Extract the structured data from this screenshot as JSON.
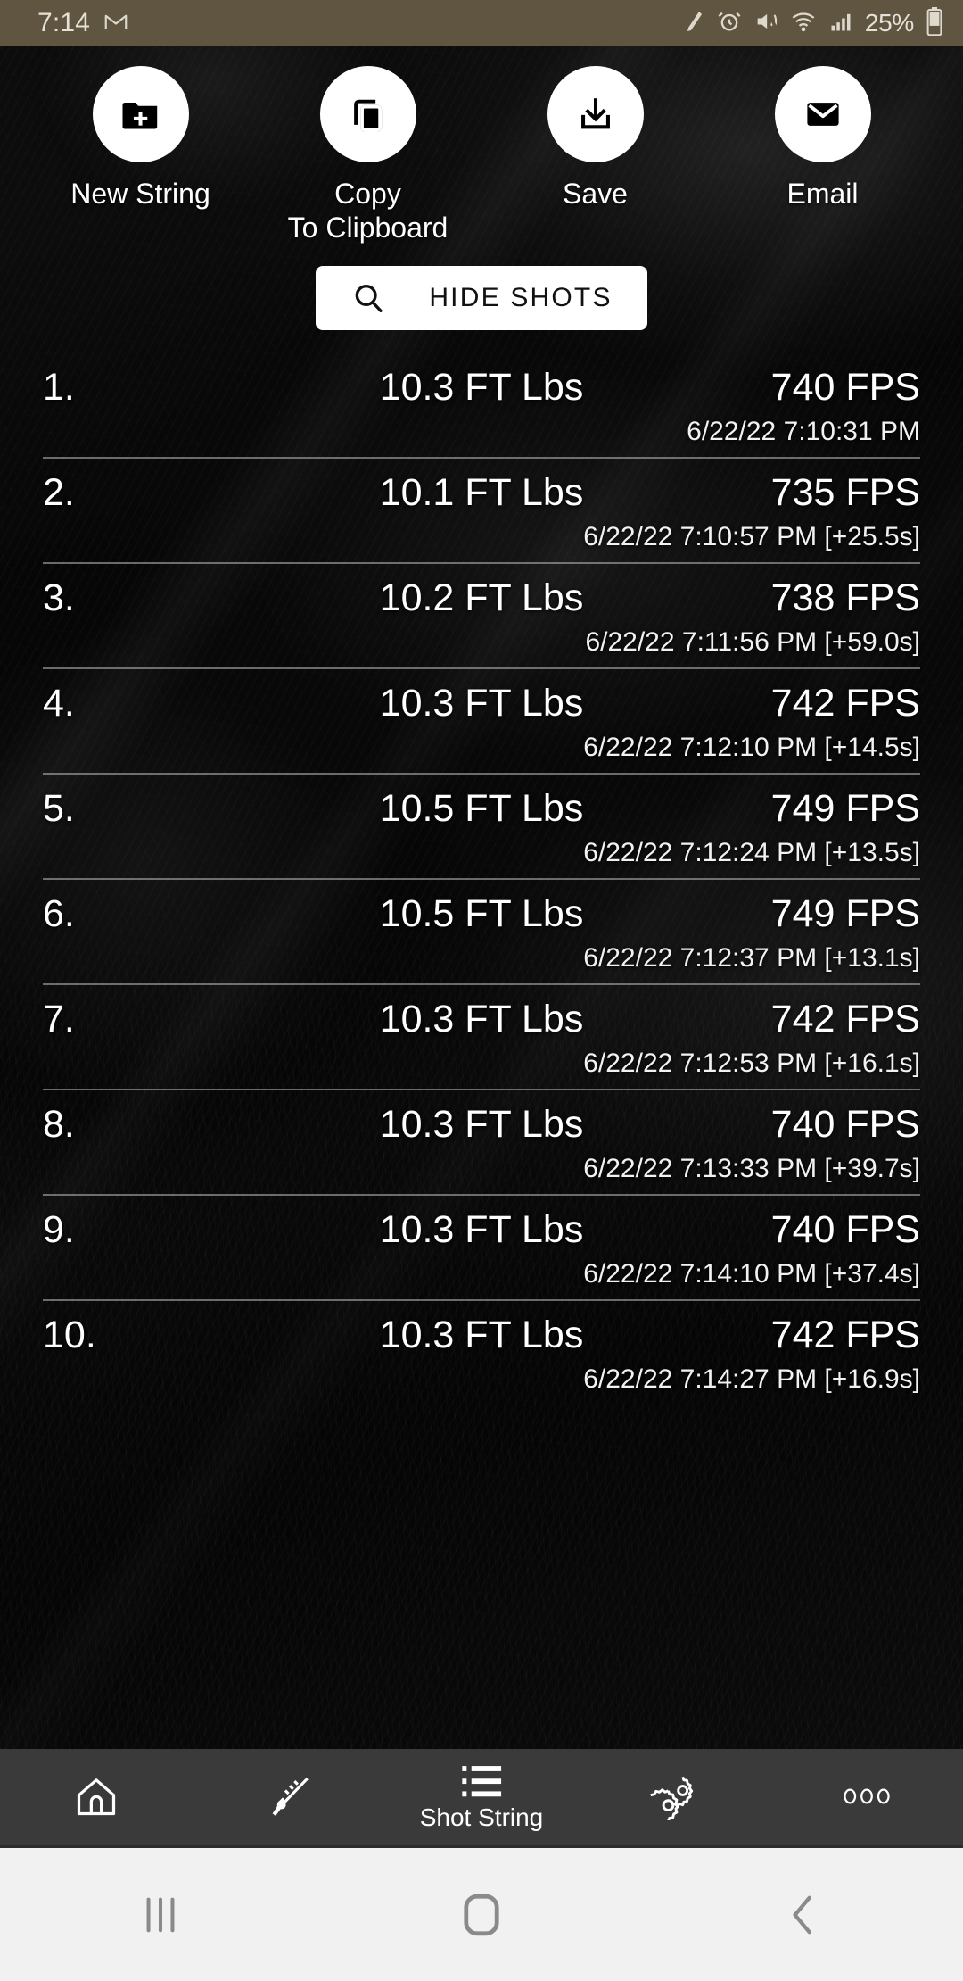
{
  "status_bar": {
    "time": "7:14",
    "gmail_icon": "gmail-icon",
    "battery_percent": "25%",
    "icons": [
      "pencil-icon",
      "alarm-icon",
      "mute-icon",
      "wifi-icon",
      "signal-icon",
      "battery-icon"
    ]
  },
  "actions": [
    {
      "label": "New String",
      "icon": "folder-plus-icon"
    },
    {
      "label": "Copy\nTo Clipboard",
      "icon": "copy-icon"
    },
    {
      "label": "Save",
      "icon": "download-icon"
    },
    {
      "label": "Email",
      "icon": "email-icon"
    }
  ],
  "hide_shots": {
    "label": "HIDE SHOTS",
    "icon": "search-icon"
  },
  "shot_list": {
    "energy_unit": "FT Lbs",
    "speed_unit": "FPS",
    "rows": [
      {
        "index": "1.",
        "energy": "10.3 FT Lbs",
        "speed": "740 FPS",
        "stamp": "6/22/22 7:10:31 PM"
      },
      {
        "index": "2.",
        "energy": "10.1 FT Lbs",
        "speed": "735 FPS",
        "stamp": "6/22/22 7:10:57 PM [+25.5s]"
      },
      {
        "index": "3.",
        "energy": "10.2 FT Lbs",
        "speed": "738 FPS",
        "stamp": "6/22/22 7:11:56 PM [+59.0s]"
      },
      {
        "index": "4.",
        "energy": "10.3 FT Lbs",
        "speed": "742 FPS",
        "stamp": "6/22/22 7:12:10 PM [+14.5s]"
      },
      {
        "index": "5.",
        "energy": "10.5 FT Lbs",
        "speed": "749 FPS",
        "stamp": "6/22/22 7:12:24 PM [+13.5s]"
      },
      {
        "index": "6.",
        "energy": "10.5 FT Lbs",
        "speed": "749 FPS",
        "stamp": "6/22/22 7:12:37 PM [+13.1s]"
      },
      {
        "index": "7.",
        "energy": "10.3 FT Lbs",
        "speed": "742 FPS",
        "stamp": "6/22/22 7:12:53 PM [+16.1s]"
      },
      {
        "index": "8.",
        "energy": "10.3 FT Lbs",
        "speed": "740 FPS",
        "stamp": "6/22/22 7:13:33 PM [+39.7s]"
      },
      {
        "index": "9.",
        "energy": "10.3 FT Lbs",
        "speed": "740 FPS",
        "stamp": "6/22/22 7:14:10 PM [+37.4s]"
      },
      {
        "index": "10.",
        "energy": "10.3 FT Lbs",
        "speed": "742 FPS",
        "stamp": "6/22/22 7:14:27 PM [+16.9s]"
      }
    ]
  },
  "tab_bar": {
    "tabs": [
      {
        "label": "",
        "icon": "home-icon",
        "active": false
      },
      {
        "label": "",
        "icon": "rifle-icon",
        "active": false
      },
      {
        "label": "Shot String",
        "icon": "list-icon",
        "active": true
      },
      {
        "label": "",
        "icon": "gears-icon",
        "active": false
      },
      {
        "label": "",
        "icon": "more-dots-icon",
        "active": false
      }
    ]
  },
  "nav_bar": {
    "recents": "recents-icon",
    "home": "home-square-icon",
    "back": "back-chevron-icon"
  },
  "colors": {
    "status_bar_bg": "#5f5540",
    "tab_bar_bg": "#3a3a3a",
    "nav_bar_bg": "#f1f1f1",
    "accent_white": "#ffffff"
  }
}
